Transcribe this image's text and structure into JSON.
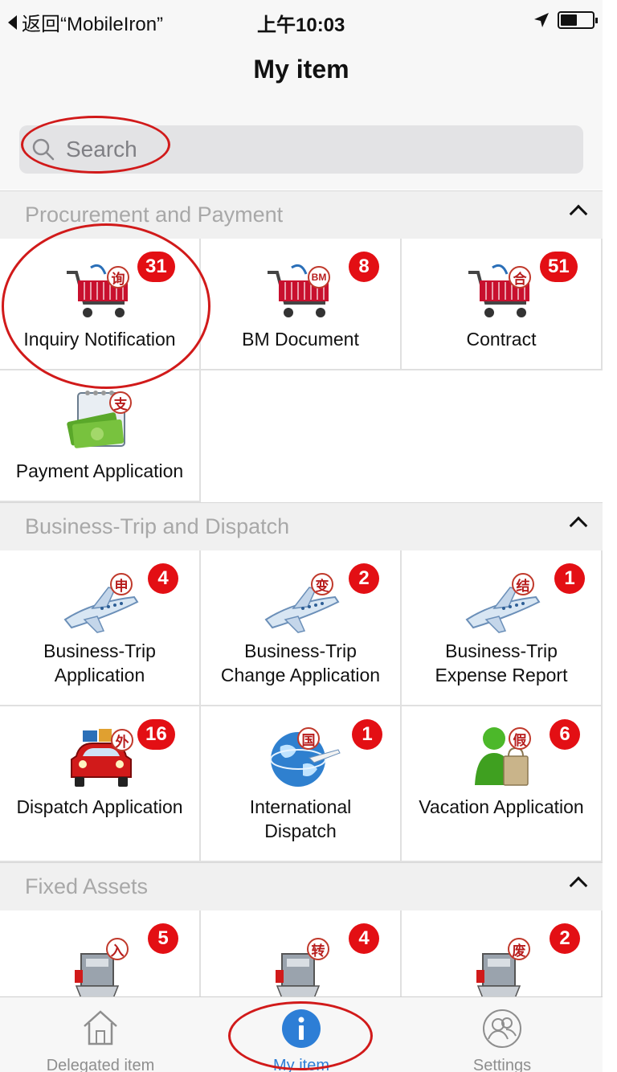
{
  "status_bar": {
    "back_label": "返回“MobileIron”",
    "time": "上午10:03"
  },
  "nav": {
    "title": "My item"
  },
  "search": {
    "placeholder": "Search"
  },
  "sections": [
    {
      "title": "Procurement and Payment",
      "items": [
        {
          "label": "Inquiry Notification",
          "badge": "31",
          "icon": "cart-icon",
          "char": "询"
        },
        {
          "label": "BM Document",
          "badge": "8",
          "icon": "cart-icon",
          "char": "BM"
        },
        {
          "label": "Contract",
          "badge": "51",
          "icon": "cart-icon",
          "char": "合"
        },
        {
          "label": "Payment Application",
          "badge": "",
          "icon": "money-icon",
          "char": "支"
        }
      ]
    },
    {
      "title": "Business-Trip and Dispatch",
      "items": [
        {
          "label1": "Business-Trip",
          "label2": "Application",
          "badge": "4",
          "icon": "airplane-icon",
          "char": "申"
        },
        {
          "label1": "Business-Trip",
          "label2": "Change Application",
          "badge": "2",
          "icon": "airplane-icon",
          "char": "变"
        },
        {
          "label1": "Business-Trip",
          "label2": "Expense Report",
          "badge": "1",
          "icon": "airplane-icon",
          "char": "结"
        },
        {
          "label": "Dispatch Application",
          "badge": "16",
          "icon": "car-icon",
          "char": "外"
        },
        {
          "label1": "International",
          "label2": "Dispatch",
          "badge": "1",
          "icon": "globe-icon",
          "char": "国"
        },
        {
          "label": "Vacation Application",
          "badge": "6",
          "icon": "person-bag-icon",
          "char": "假"
        }
      ]
    },
    {
      "title": "Fixed Assets",
      "items": [
        {
          "badge": "5",
          "icon": "asset-icon",
          "char": "入"
        },
        {
          "badge": "4",
          "icon": "asset-icon",
          "char": "转"
        },
        {
          "badge": "2",
          "icon": "asset-icon",
          "char": "废"
        }
      ]
    }
  ],
  "tab_bar": {
    "tabs": [
      {
        "label": "Delegated item",
        "icon": "home-icon"
      },
      {
        "label": "My item",
        "icon": "info-icon",
        "active": true
      },
      {
        "label": "Settings",
        "icon": "people-icon"
      }
    ]
  },
  "colors": {
    "badge": "#e30f14",
    "active_tab": "#2d7ed6",
    "annotation": "#d11a1a"
  }
}
